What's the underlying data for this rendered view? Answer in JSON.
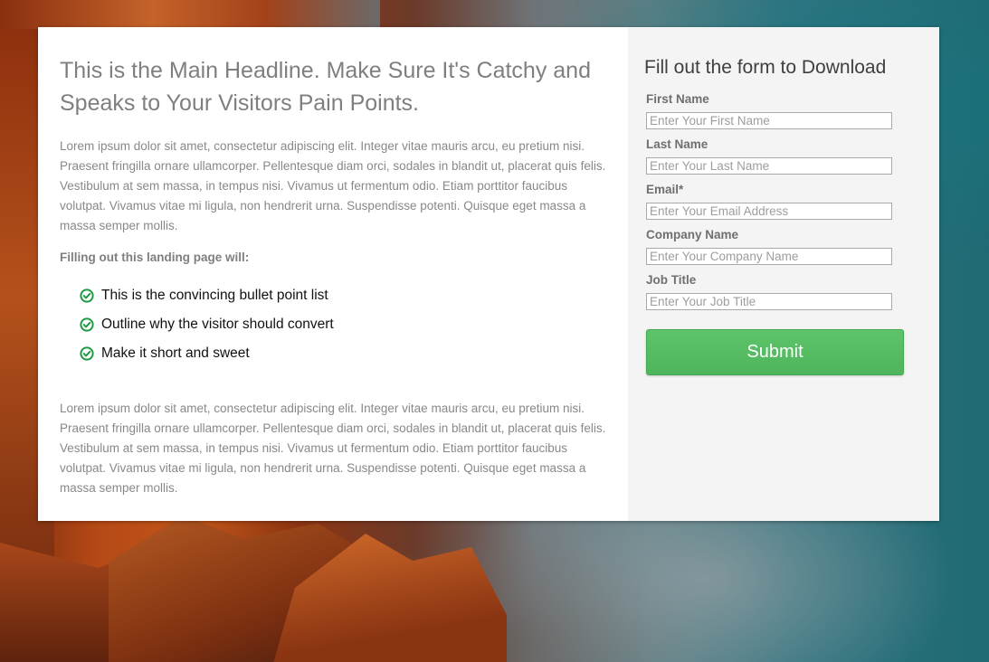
{
  "colors": {
    "accent_green": "#55bb61",
    "check_green": "#1f9a43",
    "form_background": "#f4f4f4"
  },
  "main": {
    "headline": "This is the Main Headline. Make Sure It's Catchy and Speaks to Your Visitors Pain Points.",
    "paragraph_1": "Lorem ipsum dolor sit amet, consectetur adipiscing elit. Integer vitae mauris arcu, eu pretium nisi. Praesent fringilla ornare ullamcorper. Pellentesque diam orci, sodales in blandit ut, placerat quis felis. Vestibulum at sem massa, in tempus nisi. Vivamus ut fermentum odio. Etiam porttitor faucibus volutpat. Vivamus vitae mi ligula, non hendrerit urna. Suspendisse potenti. Quisque eget massa a massa semper mollis.",
    "subheading": "Filling out this landing page will:",
    "bullets": [
      {
        "text": "This is the convincing bullet point list",
        "icon": "check-circle-icon"
      },
      {
        "text": "Outline why the visitor should convert",
        "icon": "check-circle-icon"
      },
      {
        "text": "Make it short and sweet",
        "icon": "check-circle-icon"
      }
    ],
    "paragraph_2": "Lorem ipsum dolor sit amet, consectetur adipiscing elit. Integer vitae mauris arcu, eu pretium nisi. Praesent fringilla ornare ullamcorper. Pellentesque diam orci, sodales in blandit ut, placerat quis felis. Vestibulum at sem massa, in tempus nisi. Vivamus ut fermentum odio. Etiam porttitor faucibus volutpat. Vivamus vitae mi ligula, non hendrerit urna. Suspendisse potenti. Quisque eget massa a massa semper mollis."
  },
  "form": {
    "title": "Fill out the form to Download",
    "fields": [
      {
        "label": "First Name",
        "placeholder": "Enter Your First Name",
        "value": ""
      },
      {
        "label": "Last Name",
        "placeholder": "Enter Your Last Name",
        "value": ""
      },
      {
        "label": "Email*",
        "placeholder": "Enter Your Email Address",
        "value": ""
      },
      {
        "label": "Company Name",
        "placeholder": "Enter Your Company Name",
        "value": ""
      },
      {
        "label": "Job Title",
        "placeholder": "Enter Your Job Title",
        "value": ""
      }
    ],
    "submit_label": "Submit"
  }
}
